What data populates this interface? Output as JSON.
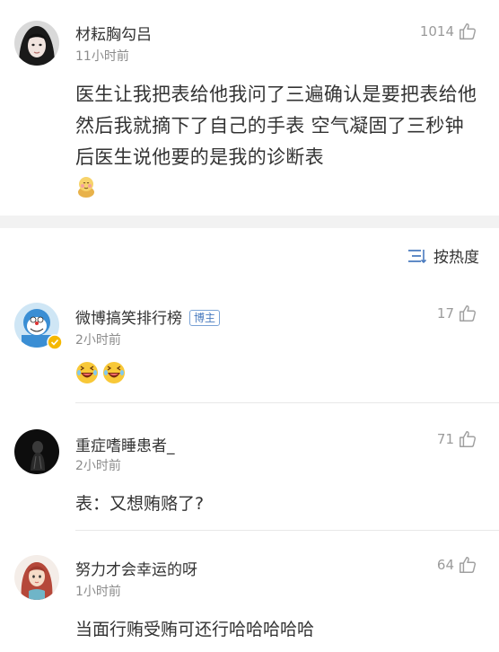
{
  "post": {
    "username": "材耘胸勾吕",
    "time": "11小时前",
    "likes": "1014",
    "text": "医生让我把表给他我问了三遍确认是要把表给他然后我就摘下了自己的手表 空气凝固了三秒钟后医生说他要的是我的诊断表"
  },
  "sort": {
    "label": "按热度"
  },
  "comments": [
    {
      "username": "微博搞笑排行榜",
      "badge": "博主",
      "time": "2小时前",
      "likes": "17",
      "text": ""
    },
    {
      "username": "重症嗜睡患者_",
      "time": "2小时前",
      "likes": "71",
      "text": "表：又想贿赂了?"
    },
    {
      "username": "努力才会幸运的呀",
      "time": "1小时前",
      "likes": "64",
      "text": "当面行贿受贿可还行哈哈哈哈哈"
    }
  ],
  "colors": {
    "text": "#333333",
    "meta": "#8c8c8c",
    "badge": "#4a7bbf",
    "separator": "#f2f2f2"
  },
  "icons": [
    "thumbs-up-icon",
    "sort-icon",
    "verified-icon",
    "laughing-emoji",
    "shy-emoji"
  ]
}
